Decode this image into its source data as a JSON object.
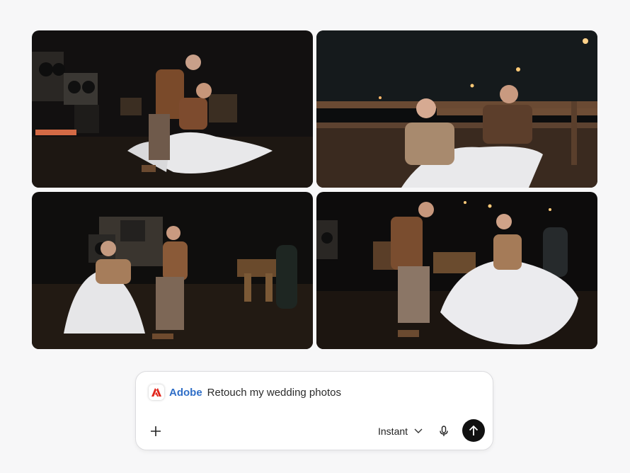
{
  "prompt": {
    "brand": "Adobe",
    "text": "Retouch my wedding photos",
    "mode": "Instant",
    "icons": {
      "brand": "adobe-logo-icon",
      "add": "plus-icon",
      "mode": "chevron-down-icon",
      "mic": "microphone-icon",
      "send": "arrow-up-icon"
    },
    "colors": {
      "brand": "#2f6ec7",
      "logo": "#e1251b",
      "send": "#111111"
    }
  },
  "photos": [
    {
      "id": "photo-1"
    },
    {
      "id": "photo-2"
    },
    {
      "id": "photo-3"
    },
    {
      "id": "photo-4"
    }
  ]
}
